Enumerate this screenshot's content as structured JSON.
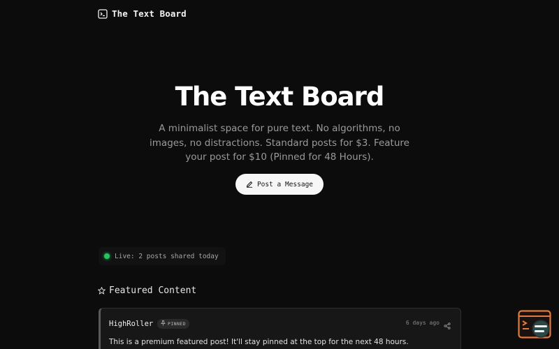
{
  "header": {
    "brand": "The Text Board",
    "logo_icon": "terminal-icon"
  },
  "hero": {
    "title": "The Text Board",
    "description": "A minimalist space for pure text. No algorithms, no images, no distractions. Standard posts for $3. Feature your post for $10 (Pinned for 48 Hours).",
    "post_button_label": "Post a Message",
    "post_button_icon": "pencil-icon"
  },
  "live": {
    "text": "Live: 2 posts shared today",
    "color": "#22c55e"
  },
  "featured": {
    "heading": "Featured Content",
    "icon": "star-icon"
  },
  "posts": [
    {
      "author": "HighRoller",
      "badge": "PINNED",
      "badge_icon": "pin-icon",
      "time": "6 days ago",
      "text": "This is a premium featured post! It'll stay pinned at the top for the next 48 hours.",
      "share_icon": "share-icon"
    }
  ],
  "widget": {
    "icon": "terminal-chat-icon",
    "accent": "#e07b3c"
  },
  "colors": {
    "background": "#0d0c0c",
    "button_bg": "#f7f7f7",
    "card_bg": "#171717"
  }
}
